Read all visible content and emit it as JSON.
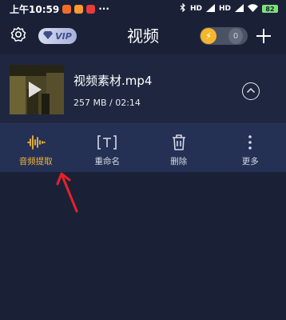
{
  "status_bar": {
    "time": "上午10:59",
    "battery": "82",
    "signal_labels": [
      "HD",
      "HD"
    ]
  },
  "header": {
    "title": "视频",
    "vip_label": "VIP",
    "coin_count": "0"
  },
  "file": {
    "name": "视频素材.mp4",
    "meta": "257 MB / 02:14"
  },
  "actions": [
    {
      "label": "音频提取",
      "icon": "audio-waveform-icon",
      "active": true
    },
    {
      "label": "重命名",
      "icon": "rename-icon",
      "active": false
    },
    {
      "label": "删除",
      "icon": "trash-icon",
      "active": false
    },
    {
      "label": "更多",
      "icon": "more-vertical-icon",
      "active": false
    }
  ],
  "colors": {
    "background": "#1a2137",
    "action_bar": "#243054",
    "accent": "#f0b73a",
    "arrow": "#e8202a"
  }
}
